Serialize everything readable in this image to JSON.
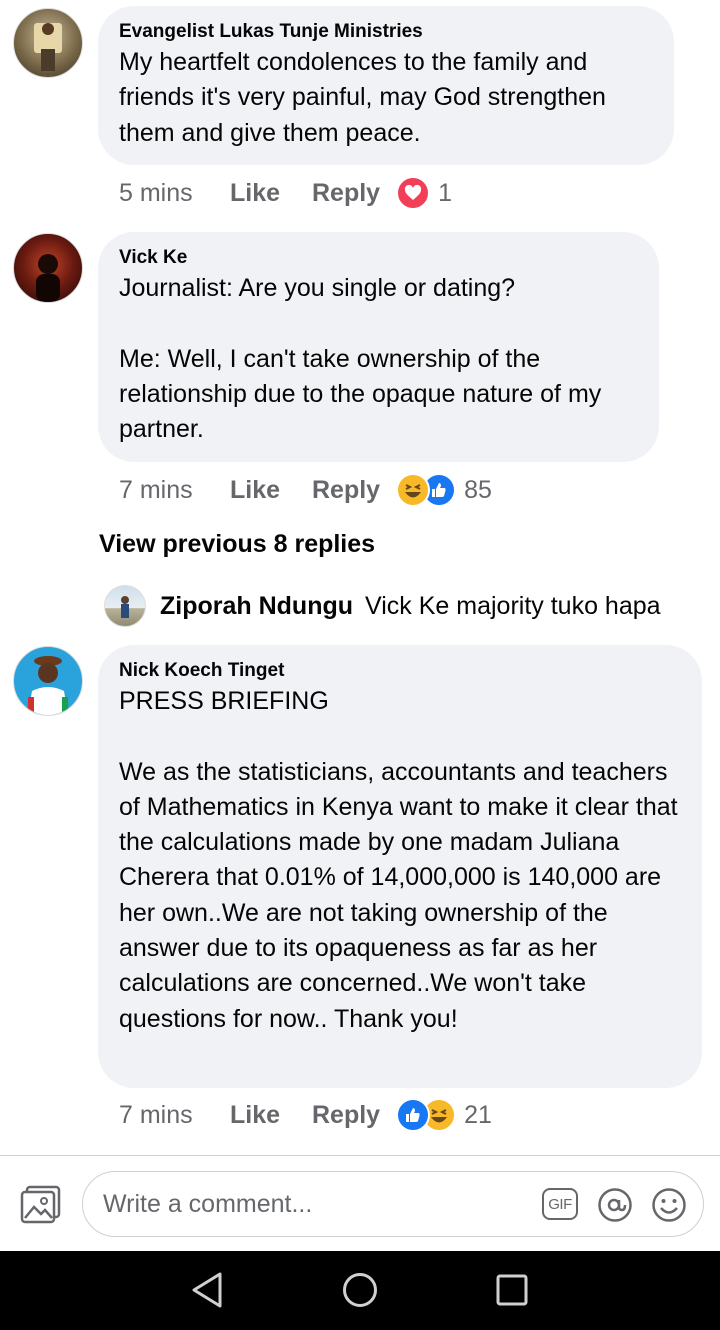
{
  "comments": [
    {
      "author": "Evangelist  Lukas Tunje Ministries",
      "text": "My heartfelt condolences to the family and friends it's very  painful, may  God strengthen them and give them peace.",
      "time": "5 mins",
      "like_label": "Like",
      "reply_label": "Reply",
      "reactions": [
        "heart-icon"
      ],
      "reaction_count": "1"
    },
    {
      "author": "Vick Ke",
      "text": "Journalist: Are you single or dating?\n\nMe: Well, I can't take ownership of the relationship due to the opaque nature of my partner.",
      "time": "7 mins",
      "like_label": "Like",
      "reply_label": "Reply",
      "reactions": [
        "haha-icon",
        "thumbs-up-icon"
      ],
      "reaction_count": "85"
    },
    {
      "author": "Nick Koech Tinget",
      "text": "PRESS BRIEFING\n\nWe as the statisticians, accountants and teachers of Mathematics in Kenya want to make it clear that the calculations made by one madam Juliana Cherera that 0.01% of 14,000,000 is 140,000 are her own..We are not taking ownership of the answer due to its opaqueness as far as her calculations are concerned..We won't take questions for now.. Thank you!",
      "time": "7 mins",
      "like_label": "Like",
      "reply_label": "Reply",
      "reactions": [
        "thumbs-up-icon",
        "haha-icon"
      ],
      "reaction_count": "21"
    }
  ],
  "view_previous": "View previous 8 replies",
  "nested_reply": {
    "author": "Ziporah Ndungu",
    "text": "Vick Ke majority tuko hapa"
  },
  "composer": {
    "placeholder": "Write a comment...",
    "gif_label": "GIF"
  },
  "colors": {
    "bubble": "#f0f2f5",
    "meta_text": "#65676b",
    "like_blue": "#1877f2",
    "heart_red": "#f33e58",
    "haha_yellow": "#f7b928"
  }
}
